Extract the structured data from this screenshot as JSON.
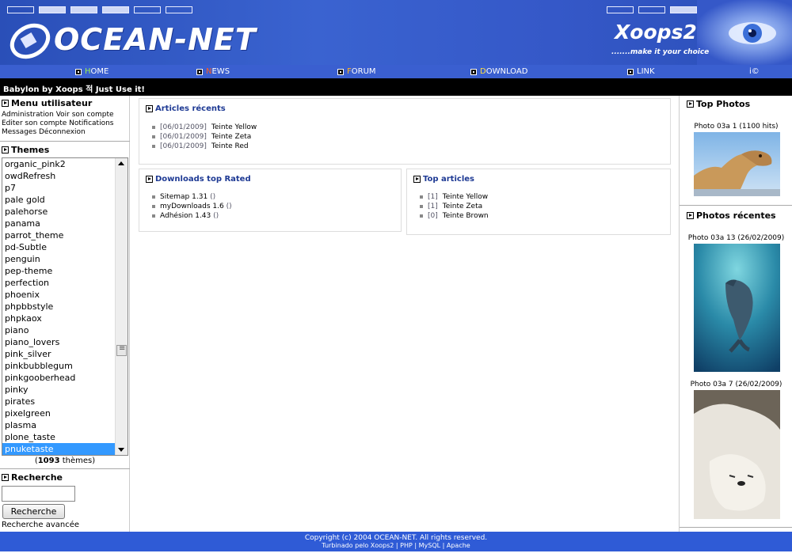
{
  "header": {
    "logo_text": "OCEAN-NET",
    "xoops_title": "Xoops2",
    "xoops_slogan": ".......make it your choice"
  },
  "nav": {
    "items": [
      {
        "first": "H",
        "rest": "OME"
      },
      {
        "first": "N",
        "rest": "EWS"
      },
      {
        "first": "F",
        "rest": "ORUM"
      },
      {
        "first": "D",
        "rest": "OWNLOAD"
      },
      {
        "first": "L",
        "rest": "INK"
      },
      {
        "first": "i",
        "rest": "©"
      }
    ]
  },
  "banner": "Babylon by Xoops 적 Just Use it!",
  "user_menu": {
    "title": "Menu utilisateur",
    "line1": "Administration Voir son compte",
    "line2": "Editer son compte Notifications",
    "line3": "Messages Déconnexion"
  },
  "themes": {
    "title": "Themes",
    "items": [
      "organic_pink2",
      "owdRefresh",
      "p7",
      "pale gold",
      "palehorse",
      "panama",
      "parrot_theme",
      "pd-Subtle",
      "penguin",
      "pep-theme",
      "perfection",
      "phoenix",
      "phpbbstyle",
      "phpkaox",
      "piano",
      "piano_lovers",
      "pink_silver",
      "pinkbubblegum",
      "pinkgooberhead",
      "pinky",
      "pirates",
      "pixelgreen",
      "plasma",
      "plone_taste",
      "pnuketaste"
    ],
    "selected": "pnuketaste",
    "count_number": "1093",
    "count_label": "thèmes"
  },
  "search": {
    "title": "Recherche",
    "button": "Recherche",
    "input_value": "",
    "advanced": "Recherche avancée"
  },
  "center": {
    "recent": {
      "title": "Articles récents",
      "items": [
        {
          "date": "[06/01/2009]",
          "name": "Teinte Yellow"
        },
        {
          "date": "[06/01/2009]",
          "name": "Teinte Zeta"
        },
        {
          "date": "[06/01/2009]",
          "name": "Teinte Red"
        }
      ]
    },
    "downloads": {
      "title": "Downloads top Rated",
      "items": [
        {
          "name": "Sitemap 1.31",
          "extra": "()"
        },
        {
          "name": "myDownloads 1.6",
          "extra": "()"
        },
        {
          "name": "Adhésion 1.43",
          "extra": "()"
        }
      ]
    },
    "top_articles": {
      "title": "Top articles",
      "items": [
        {
          "count": "[1]",
          "name": "Teinte Yellow"
        },
        {
          "count": "[1]",
          "name": "Teinte Zeta"
        },
        {
          "count": "[0]",
          "name": "Teinte Brown"
        }
      ]
    }
  },
  "right": {
    "top_photos_title": "Top Photos",
    "top_photo_caption": "Photo 03a 1 (1100 hits)",
    "recent_title": "Photos récentes",
    "recent_photo1_caption": "Photo 03a 13 (26/02/2009)",
    "recent_photo2_caption": "Photo 03a 7 (26/02/2009)"
  },
  "footer": {
    "copyright": "Copyright (c)  2004 OCEAN-NET. All rights reserved.",
    "powered": "Turbinado pelo Xoops2 | PHP | MySQL | Apache"
  }
}
